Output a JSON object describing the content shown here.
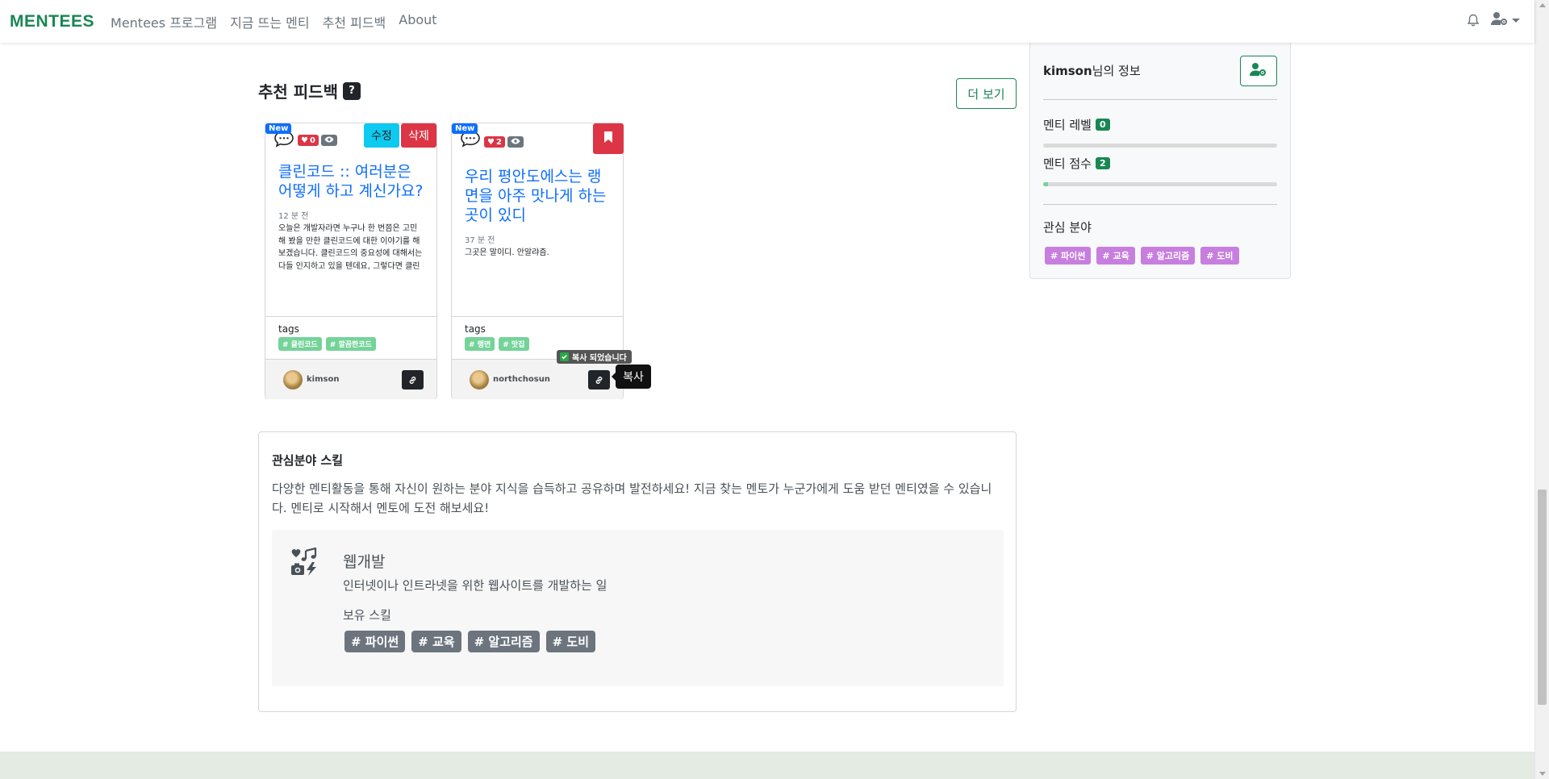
{
  "navbar": {
    "brand": "MENTEES",
    "links": [
      "Mentees 프로그램",
      "지금 뜨는 멘티",
      "추천 피드백",
      "About"
    ]
  },
  "feedback": {
    "title": "추천 피드백",
    "help_label": "?",
    "more_label": "더 보기",
    "cards": [
      {
        "new_label": "New",
        "likes": "0",
        "edit_label": "수정",
        "delete_label": "삭제",
        "title": "클린코드 :: 여러분은 어떻게 하고 계신가요?",
        "time": "12 분 전",
        "text": "오늘은 개발자라면 누구나 한 번쯤은 고민해 봤을 만한 클린코드에 대한 이야기를 해보겠습니다. 클린코드의 중요성에 대해서는 다들 인지하고 있을 텐데요, 그렇다면 클린코드를 한마디로 ...",
        "tags_label": "tags",
        "tags": [
          "# 클린코드",
          "# 깔끔한코드"
        ],
        "user": "kimson"
      },
      {
        "new_label": "New",
        "likes": "2",
        "title": "우리 평안도에스는 랭면을 아주 맛나게 하는 곳이 있디",
        "time": "37 분 전",
        "text": "그곳은 말이디. 안알랴즘.",
        "tags_label": "tags",
        "tags": [
          "# 랭면",
          "# 맛집"
        ],
        "user": "northchosun"
      }
    ],
    "copied_toast": "복사 되었습니다",
    "copy_tooltip": "복사"
  },
  "skills": {
    "title": "관심분야 스킬",
    "description": "다양한 멘티활동을 통해 자신이 원하는 분야 지식을 습득하고 공유하며 발전하세요! 지금 찾는 멘토가 누군가에게 도움 받던 멘티였을 수 있습니다. 멘티로 시작해서 멘토에 도전 해보세요!",
    "panel": {
      "name": "웹개발",
      "subtitle": "인터넷이나 인트라넷을 위한 웹사이트를 개발하는 일",
      "owned_label": "보유 스킬",
      "tags": [
        "# 파이썬",
        "# 교육",
        "# 알고리즘",
        "# 도비"
      ]
    }
  },
  "sidebar": {
    "user_name": "kimson",
    "title_suffix": "님의 정보",
    "level_label": "멘티 레벨",
    "level_value": "0",
    "level_progress": 0,
    "score_label": "멘티 점수",
    "score_value": "2",
    "score_progress": 0.02,
    "interest_label": "관심 분야",
    "interest_tags": [
      "# 파이썬",
      "# 교육",
      "# 알고리즘",
      "# 도비"
    ]
  },
  "colors": {
    "brand": "#198754",
    "link": "#0d6efd",
    "danger": "#dc3545",
    "info": "#0dcaf0",
    "tag_green": "#75d39a",
    "tag_purple": "#c77ede",
    "tag_gray": "#6c757d"
  },
  "icons": {
    "bell": "bell-icon",
    "user_gear": "user-gear-icon",
    "bubble": "comment-dots-icon",
    "heart": "heart-icon",
    "eye": "eye-icon",
    "bookmark": "bookmark-icon",
    "link": "link-icon",
    "check": "check-icon",
    "skill": "web-dev-icon"
  }
}
